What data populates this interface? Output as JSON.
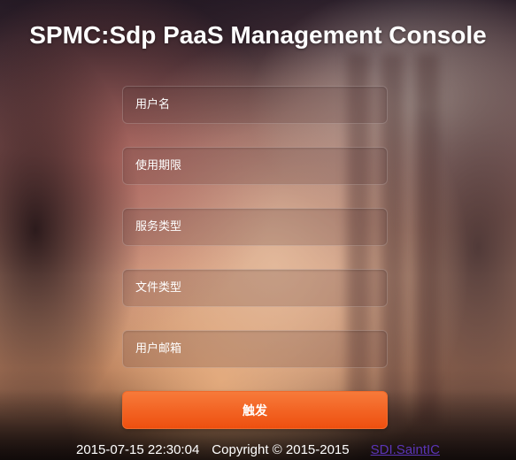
{
  "header": {
    "title": "SPMC:Sdp PaaS Management Console"
  },
  "form": {
    "fields": [
      {
        "placeholder": "用户名",
        "value": ""
      },
      {
        "placeholder": "使用期限",
        "value": ""
      },
      {
        "placeholder": "服务类型",
        "value": ""
      },
      {
        "placeholder": "文件类型",
        "value": ""
      },
      {
        "placeholder": "用户邮箱",
        "value": ""
      }
    ],
    "submit_label": "触发"
  },
  "footer": {
    "datetime": "2015-07-15 22:30:04",
    "copyright": "Copyright © 2015-2015",
    "link_text": "SDI.SaintIC"
  },
  "colors": {
    "accent": "#ee4f0f",
    "link": "#5b35b8",
    "title": "#ffffff"
  }
}
